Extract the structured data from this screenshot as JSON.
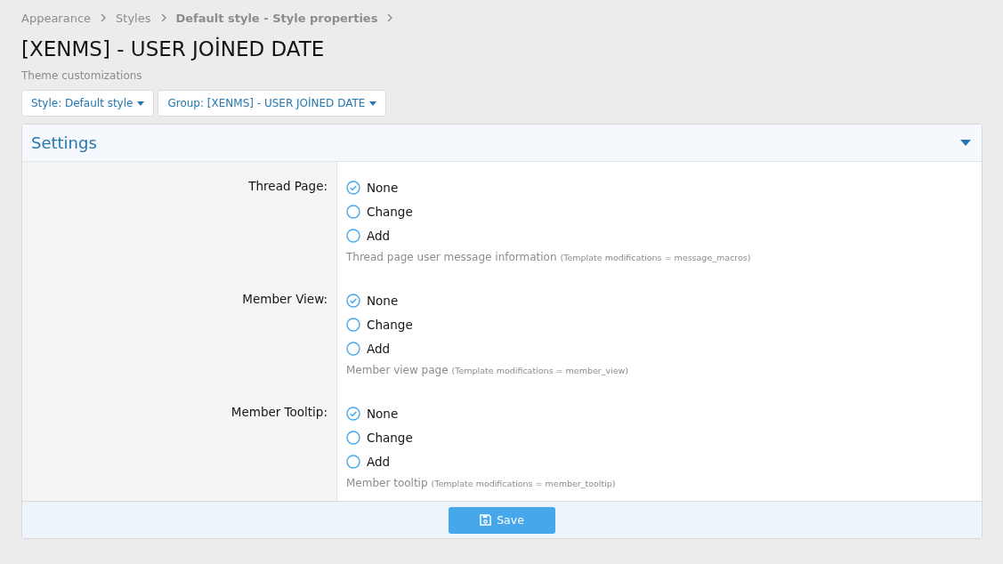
{
  "breadcrumb": [
    {
      "label": "Appearance",
      "current": false
    },
    {
      "label": "Styles",
      "current": false
    },
    {
      "label": "Default style - Style properties",
      "current": true
    }
  ],
  "title": "[XENMS] - USER JOİNED DATE",
  "subtitle": "Theme customizations",
  "filters": [
    "Style: Default style",
    "Group: [XENMS] - USER JOİNED DATE"
  ],
  "panel": {
    "title": "Settings",
    "expanded": true,
    "rows": [
      {
        "label": "Thread Page:",
        "options": [
          {
            "label": "None",
            "selected": true
          },
          {
            "label": "Change",
            "selected": false
          },
          {
            "label": "Add",
            "selected": false
          }
        ],
        "explain": "Thread page user message information",
        "note": "(Template modifications = message_macros)"
      },
      {
        "label": "Member View:",
        "options": [
          {
            "label": "None",
            "selected": true
          },
          {
            "label": "Change",
            "selected": false
          },
          {
            "label": "Add",
            "selected": false
          }
        ],
        "explain": "Member view page",
        "note": "(Template modifications = member_view)"
      },
      {
        "label": "Member Tooltip:",
        "options": [
          {
            "label": "None",
            "selected": true
          },
          {
            "label": "Change",
            "selected": false
          },
          {
            "label": "Add",
            "selected": false
          }
        ],
        "explain": "Member tooltip",
        "note": "(Template modifications = member_tooltip)"
      }
    ],
    "save": "Save"
  }
}
